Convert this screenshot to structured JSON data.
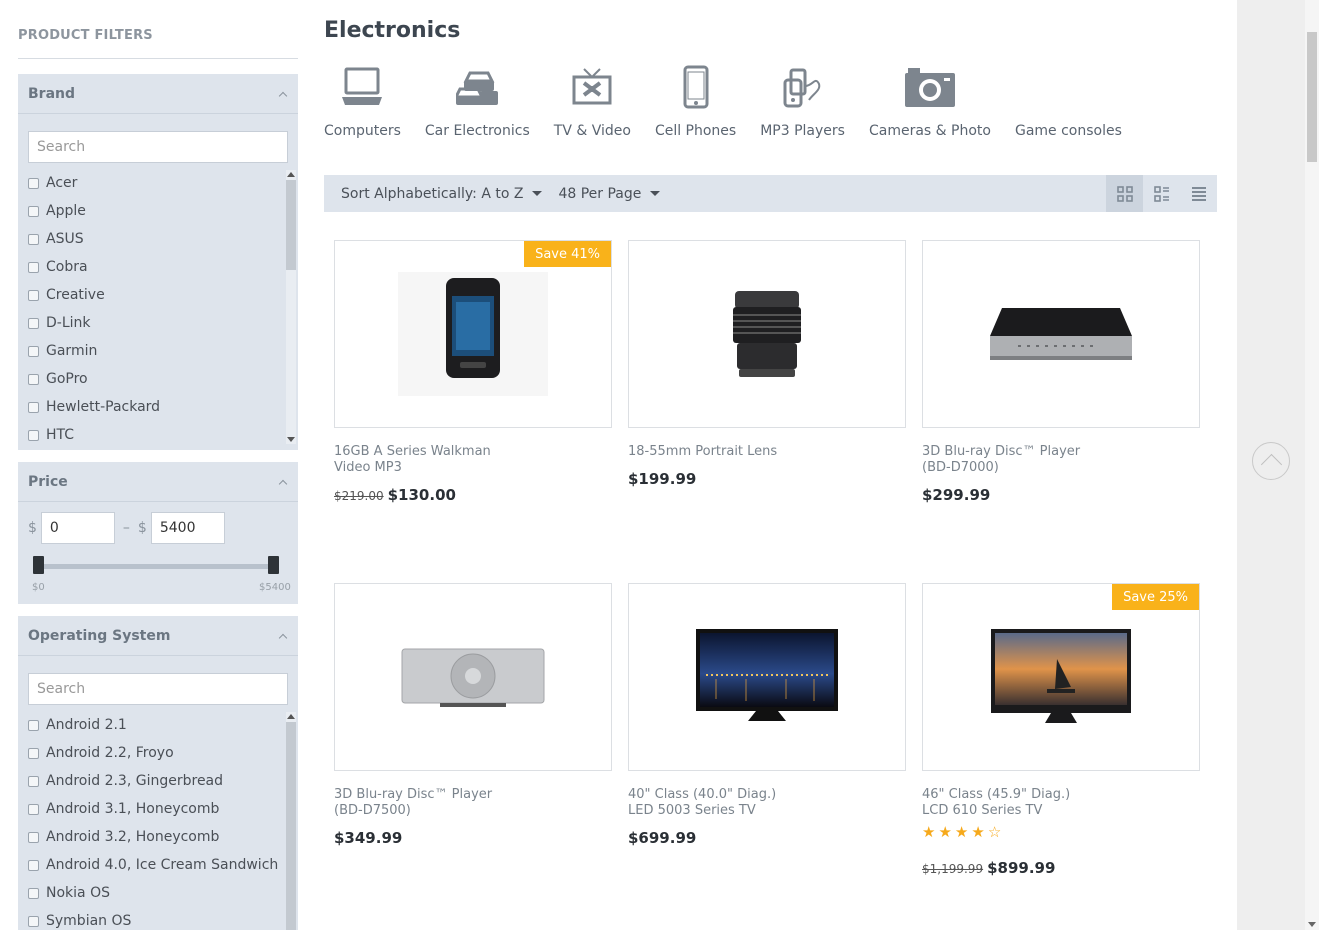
{
  "sidebar": {
    "title": "PRODUCT FILTERS",
    "brand": {
      "title": "Brand",
      "search_placeholder": "Search",
      "items": [
        "Acer",
        "Apple",
        "ASUS",
        "Cobra",
        "Creative",
        "D-Link",
        "Garmin",
        "GoPro",
        "Hewlett-Packard",
        "HTC"
      ]
    },
    "price": {
      "title": "Price",
      "currency": "$",
      "separator": "–",
      "min_value": "0",
      "max_value": "5400",
      "min_label": "$0",
      "max_label": "$5400"
    },
    "os": {
      "title": "Operating System",
      "search_placeholder": "Search",
      "items": [
        "Android 2.1",
        "Android 2.2, Froyo",
        "Android 2.3, Gingerbread",
        "Android 3.1, Honeycomb",
        "Android 3.2, Honeycomb",
        "Android 4.0, Ice Cream Sandwich",
        "Nokia OS",
        "Symbian OS"
      ]
    }
  },
  "main": {
    "title": "Electronics",
    "categories": [
      {
        "label": "Computers",
        "icon": "laptop-icon"
      },
      {
        "label": "Car Electronics",
        "icon": "cars-icon"
      },
      {
        "label": "TV & Video",
        "icon": "tv-icon"
      },
      {
        "label": "Cell Phones",
        "icon": "phone-icon"
      },
      {
        "label": "MP3 Players",
        "icon": "mp3-player-icon"
      },
      {
        "label": "Cameras & Photo",
        "icon": "camera-icon"
      },
      {
        "label": "Game consoles",
        "icon": ""
      }
    ],
    "toolbar": {
      "sort_label": "Sort Alphabetically: A to Z",
      "per_page_label": "48 Per Page"
    },
    "products": [
      {
        "name": "16GB A Series Walkman\nVideo MP3",
        "old_price": "$219.00",
        "price": "$130.00",
        "badge": "Save 41%",
        "image": "walkman"
      },
      {
        "name": "18-55mm Portrait Lens",
        "old_price": "",
        "price": "$199.99",
        "badge": "",
        "image": "lens"
      },
      {
        "name": "3D Blu-ray Disc™ Player\n(BD-D7000)",
        "old_price": "",
        "price": "$299.99",
        "badge": "",
        "image": "bluray-black"
      },
      {
        "name": "3D Blu-ray Disc™ Player\n(BD-D7500)",
        "old_price": "",
        "price": "$349.99",
        "badge": "",
        "image": "bluray-silver"
      },
      {
        "name": "40\" Class (40.0\" Diag.)\nLED 5003 Series TV",
        "old_price": "",
        "price": "$699.99",
        "badge": "",
        "image": "tv-city"
      },
      {
        "name": "46\" Class (45.9\" Diag.)\nLCD 610 Series TV",
        "old_price": "$1,199.99",
        "price": "$899.99",
        "badge": "Save 25%",
        "rating": 4,
        "image": "tv-sunset"
      }
    ]
  },
  "colors": {
    "accent": "#f9b21a",
    "panel": "#dee4ec"
  }
}
